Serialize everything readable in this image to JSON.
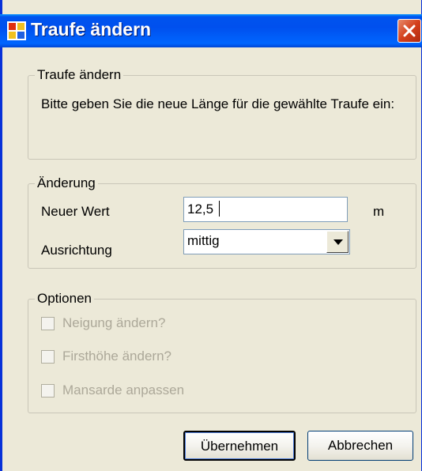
{
  "window": {
    "title": "Traufe ändern"
  },
  "info_group": {
    "legend": "Traufe ändern",
    "text": "Bitte geben Sie die neue Länge für die gewählte Traufe ein:"
  },
  "change_group": {
    "legend": "Änderung",
    "new_value_label": "Neuer Wert",
    "new_value": "12,5",
    "unit": "m",
    "alignment_label": "Ausrichtung",
    "alignment_value": "mittig"
  },
  "options_group": {
    "legend": "Optionen",
    "items": [
      {
        "label": "Neigung ändern?",
        "checked": false,
        "enabled": false
      },
      {
        "label": "Firsthöhe ändern?",
        "checked": false,
        "enabled": false
      },
      {
        "label": "Mansarde anpassen",
        "checked": false,
        "enabled": false
      }
    ]
  },
  "buttons": {
    "ok_label": "Übernehmen",
    "cancel_label": "Abbrechen"
  },
  "colors": {
    "titlebar": "#0050EE",
    "dialog_bg": "#ECE9D8",
    "close_button": "#D4401C"
  }
}
